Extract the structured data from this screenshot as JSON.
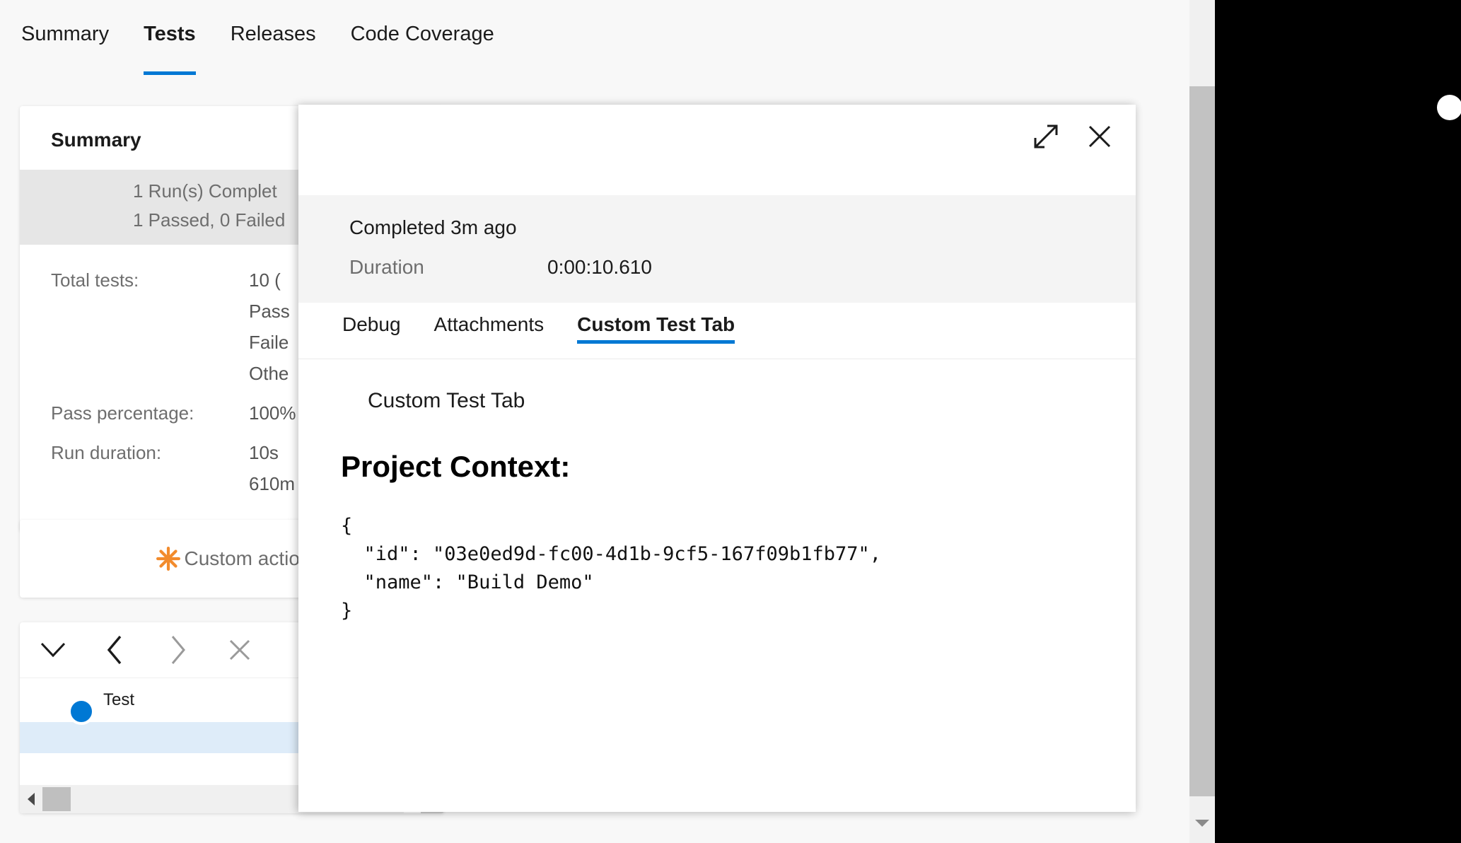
{
  "topnav": {
    "tabs": [
      {
        "label": "Summary",
        "active": false
      },
      {
        "label": "Tests",
        "active": true
      },
      {
        "label": "Releases",
        "active": false
      },
      {
        "label": "Code Coverage",
        "active": false
      }
    ]
  },
  "summary_card": {
    "title": "Summary",
    "run_banner": {
      "line1": "1 Run(s) Complet",
      "line2": "1 Passed, 0 Failed"
    },
    "stats": [
      {
        "label": "Total tests:",
        "values": [
          "10 (",
          "Pass",
          "Faile",
          "Othe"
        ]
      },
      {
        "label": "Pass percentage:",
        "values": [
          "100%"
        ]
      },
      {
        "label": "Run duration:",
        "values": [
          "10s",
          "610m"
        ]
      }
    ]
  },
  "custom_action": {
    "label": "Custom action",
    "icon": "asterisk-icon",
    "icon_color": "#f28b2c"
  },
  "results": {
    "toolbar": [
      {
        "name": "chevron-down-icon",
        "color": "#1b1b1b"
      },
      {
        "name": "previous-icon",
        "color": "#1b1b1b"
      },
      {
        "name": "next-icon",
        "color": "#9a9a9a"
      },
      {
        "name": "close-icon",
        "color": "#9a9a9a"
      }
    ],
    "grid": {
      "column_header": "Test",
      "row_status_color": "#0078d4",
      "selected_row_color": "#deecf9"
    }
  },
  "detail_panel": {
    "actions": [
      {
        "name": "expand-icon"
      },
      {
        "name": "close-icon"
      }
    ],
    "status": "Completed 3m ago",
    "duration_label": "Duration",
    "duration_value": "0:00:10.610",
    "tabs": [
      {
        "label": "Debug",
        "active": false
      },
      {
        "label": "Attachments",
        "active": false
      },
      {
        "label": "Custom Test Tab",
        "active": true
      }
    ],
    "body_title": "Custom Test Tab",
    "heading": "Project Context:",
    "code": "{\n  \"id\": \"03e0ed9d-fc00-4d1b-9cf5-167f09b1fb77\",\n  \"name\": \"Build Demo\"\n}"
  },
  "colors": {
    "accent": "#0078d4",
    "page_background": "#f8f8f8",
    "panel_background": "#ffffff",
    "meta_background": "#f4f4f4",
    "outside_background": "#000000"
  }
}
